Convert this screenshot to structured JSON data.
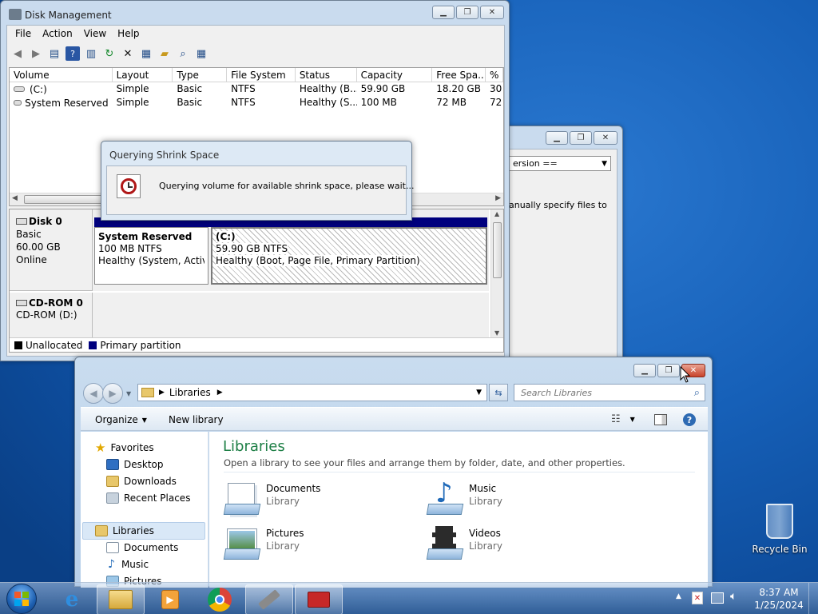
{
  "disk_management": {
    "title": "Disk Management",
    "menu": [
      "File",
      "Action",
      "View",
      "Help"
    ],
    "columns": [
      "Volume",
      "Layout",
      "Type",
      "File System",
      "Status",
      "Capacity",
      "Free Spa...",
      "% F"
    ],
    "rows": [
      {
        "volume": "(C:)",
        "layout": "Simple",
        "type": "Basic",
        "fs": "NTFS",
        "status": "Healthy (B...",
        "capacity": "59.90 GB",
        "free": "18.20 GB",
        "pct": "30"
      },
      {
        "volume": "System Reserved",
        "layout": "Simple",
        "type": "Basic",
        "fs": "NTFS",
        "status": "Healthy (S...",
        "capacity": "100 MB",
        "free": "72 MB",
        "pct": "72"
      }
    ],
    "disk0": {
      "name": "Disk 0",
      "type": "Basic",
      "size": "60.00 GB",
      "state": "Online"
    },
    "partitions": [
      {
        "name": "System Reserved",
        "size": "100 MB NTFS",
        "status": "Healthy (System, Active,"
      },
      {
        "name": "(C:)",
        "size": "59.90 GB NTFS",
        "status": "Healthy (Boot, Page File, Primary Partition)"
      }
    ],
    "cdrom": {
      "name": "CD-ROM 0",
      "sub": "CD-ROM (D:)"
    },
    "legend": [
      "Unallocated",
      "Primary partition"
    ],
    "legend_colors": {
      "unallocated": "#000000",
      "primary": "#00007e"
    }
  },
  "shrink_dialog": {
    "title": "Querying Shrink Space",
    "message": "Querying volume for available shrink space, please wait..."
  },
  "background_window": {
    "dropdown_text": "ersion ==",
    "text": "anually specify files to"
  },
  "explorer": {
    "breadcrumb": "Libraries",
    "search_placeholder": "Search Libraries",
    "toolbar": {
      "organize": "Organize",
      "new_library": "New library"
    },
    "nav": {
      "favorites": "Favorites",
      "favorites_items": [
        "Desktop",
        "Downloads",
        "Recent Places"
      ],
      "libraries": "Libraries",
      "libraries_items": [
        "Documents",
        "Music",
        "Pictures"
      ]
    },
    "heading": "Libraries",
    "subheading": "Open a library to see your files and arrange them by folder, date, and other properties.",
    "libraries": [
      {
        "name": "Documents",
        "type": "Library"
      },
      {
        "name": "Music",
        "type": "Library"
      },
      {
        "name": "Pictures",
        "type": "Library"
      },
      {
        "name": "Videos",
        "type": "Library"
      }
    ]
  },
  "desktop": {
    "recycle_bin": "Recycle Bin"
  },
  "taskbar": {
    "time": "8:37 AM",
    "date": "1/25/2024"
  },
  "colors": {
    "accent_green": "#1e7f46",
    "selection": "#d9e8f7",
    "disk_bar": "#00007e"
  }
}
